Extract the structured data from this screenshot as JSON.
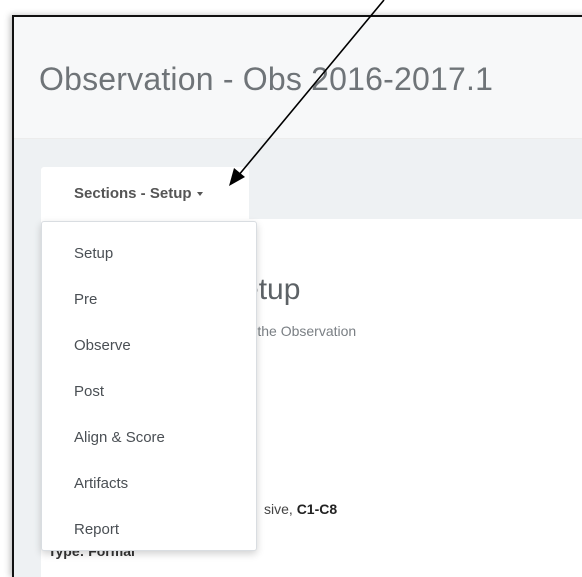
{
  "header": {
    "title": "Observation - Obs 2016-2017.1"
  },
  "sections_dropdown": {
    "label": "Sections - Setup",
    "items": [
      "Setup",
      "Pre",
      "Observe",
      "Post",
      "Align & Score",
      "Artifacts",
      "Report"
    ]
  },
  "panel": {
    "title_fragment": "Setup",
    "subtitle_fragment": "out the Observation",
    "text_fragment_prefix": "sive, ",
    "text_fragment_bold": "C1-C8",
    "text_fragment_2": "Type: Formal"
  },
  "colors": {
    "accent_text": "#555555",
    "background": "#eef1f3",
    "arrow": "#000000"
  },
  "annotation": {
    "icon": "arrow-pointer"
  }
}
